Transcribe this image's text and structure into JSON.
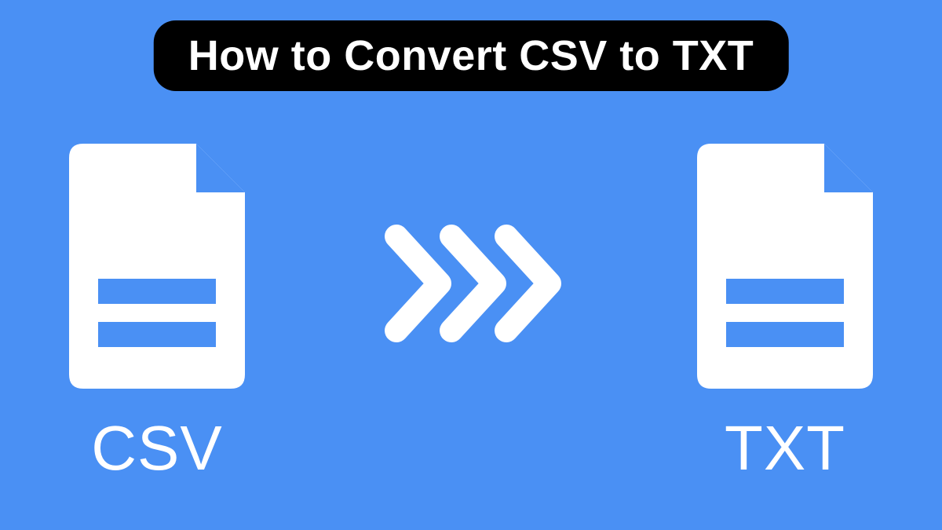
{
  "title": "How to Convert CSV to TXT",
  "source": {
    "label": "CSV",
    "icon_name": "file-document-icon"
  },
  "target": {
    "label": "TXT",
    "icon_name": "file-document-icon"
  },
  "arrow": {
    "icon_name": "triple-chevron-right-icon"
  },
  "colors": {
    "background": "#4a90f4",
    "title_bg": "#000000",
    "title_fg": "#ffffff",
    "icon_fg": "#ffffff",
    "fold_fg": "#4a90f4"
  }
}
